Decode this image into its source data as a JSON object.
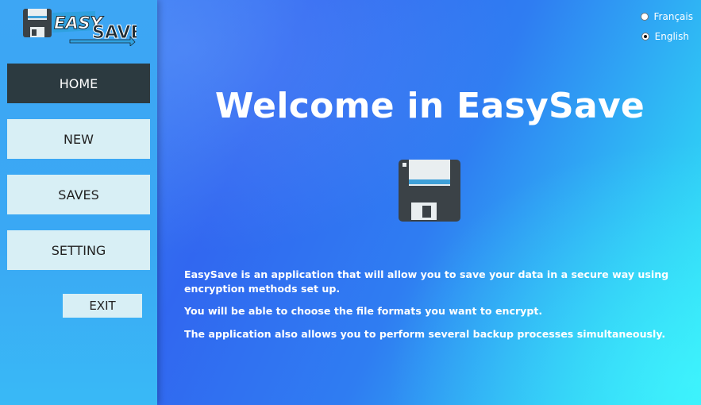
{
  "app": {
    "logo_text_1": "EASY",
    "logo_text_2": "SAVE"
  },
  "nav": {
    "home": "HOME",
    "new": "NEW",
    "saves": "SAVES",
    "setting": "SETTING",
    "exit": "EXIT"
  },
  "language": {
    "options": [
      "Français",
      "English"
    ],
    "selected": "English"
  },
  "main": {
    "title": "Welcome in EasySave",
    "paragraphs": [
      "EasySave is an application that will allow you to save your data in a secure way using encryption methods set up.",
      "You will be able to choose the file formats you want to encrypt.",
      "The application also allows you to perform several backup processes simultaneously."
    ]
  },
  "icons": {
    "logo": "floppy-disk-logo-icon",
    "hero": "floppy-disk-icon"
  },
  "colors": {
    "active_nav": "#2c3a40",
    "nav_button": "#d8eff5",
    "sidebar": "#3aa8f4",
    "floppy_body": "#3b4247",
    "floppy_stripe": "#3fa0d8"
  }
}
